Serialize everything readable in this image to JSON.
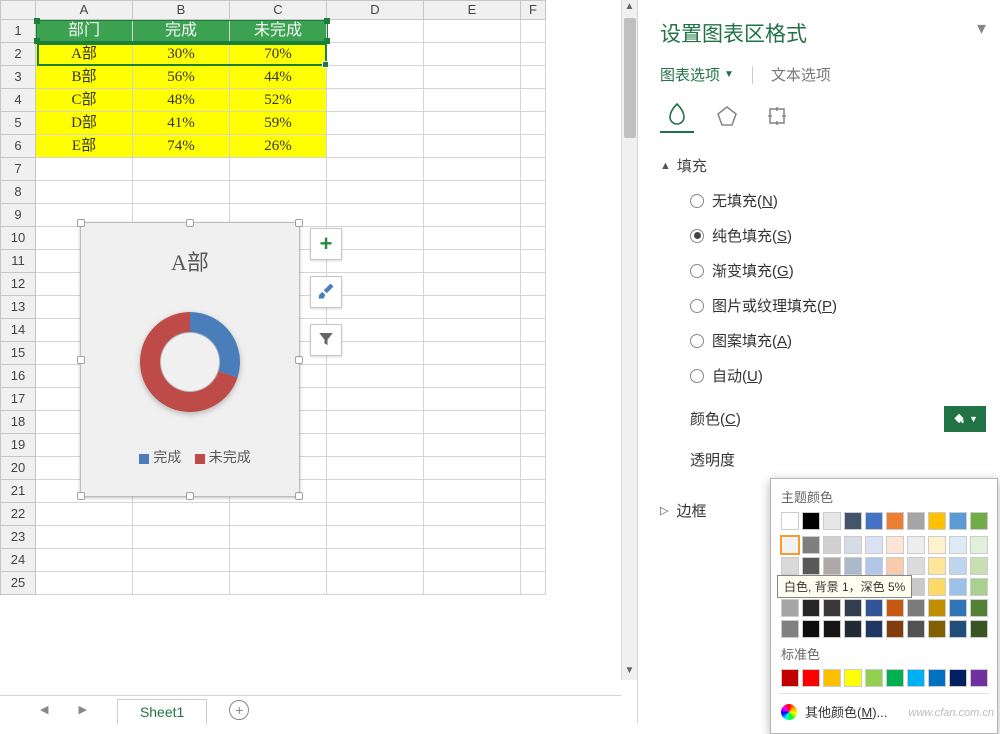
{
  "sheet": {
    "columns": [
      "A",
      "B",
      "C",
      "D",
      "E",
      "F"
    ],
    "row_numbers": [
      1,
      2,
      3,
      4,
      5,
      6,
      7,
      8,
      9,
      10,
      11,
      12,
      13,
      14,
      15,
      16,
      17,
      18,
      19,
      20,
      21,
      22,
      23,
      24,
      25
    ],
    "header_row": {
      "dept": "部门",
      "done": "完成",
      "undone": "未完成"
    },
    "data": [
      {
        "dept": "A部",
        "done": "30%",
        "undone": "70%"
      },
      {
        "dept": "B部",
        "done": "56%",
        "undone": "44%"
      },
      {
        "dept": "C部",
        "done": "48%",
        "undone": "52%"
      },
      {
        "dept": "D部",
        "done": "41%",
        "undone": "59%"
      },
      {
        "dept": "E部",
        "done": "74%",
        "undone": "26%"
      }
    ],
    "tab_name": "Sheet1"
  },
  "chart_data": {
    "type": "pie",
    "title": "A部",
    "series": [
      {
        "name": "完成",
        "value": 30,
        "color": "#4a7ebb"
      },
      {
        "name": "未完成",
        "value": 70,
        "color": "#be4b48"
      }
    ],
    "legend": {
      "done": "完成",
      "undone": "未完成"
    }
  },
  "pane": {
    "title": "设置图表区格式",
    "tab_chart_options": "图表选项",
    "tab_text_options": "文本选项",
    "section_fill": "填充",
    "radios": {
      "none": "无填充",
      "none_u": "N",
      "solid": "纯色填充",
      "solid_u": "S",
      "gradient": "渐变填充",
      "gradient_u": "G",
      "picture": "图片或纹理填充",
      "picture_u": "P",
      "pattern": "图案填充",
      "pattern_u": "A",
      "auto": "自动",
      "auto_u": "U"
    },
    "color_label": "颜色",
    "color_u": "C",
    "transparency_label": "透明度",
    "section_border": "边框"
  },
  "picker": {
    "theme_label": "主题颜色",
    "standard_label": "标准色",
    "tooltip": "白色, 背景 1，深色 5%",
    "more": "其他颜色",
    "more_u": "M",
    "theme_row0": [
      "#ffffff",
      "#000000",
      "#e7e6e6",
      "#44546a",
      "#4472c4",
      "#ed7d31",
      "#a5a5a5",
      "#ffc000",
      "#5b9bd5",
      "#70ad47"
    ],
    "theme_shades": [
      [
        "#f2f2f2",
        "#7f7f7f",
        "#d0cece",
        "#d6dce5",
        "#d9e1f2",
        "#fce4d6",
        "#ededed",
        "#fff2cc",
        "#ddebf7",
        "#e2efda"
      ],
      [
        "#d9d9d9",
        "#595959",
        "#aeaaaa",
        "#acb9ca",
        "#b4c6e7",
        "#f8cbad",
        "#dbdbdb",
        "#ffe699",
        "#bdd7ee",
        "#c6e0b4"
      ],
      [
        "#bfbfbf",
        "#404040",
        "#757171",
        "#8497b0",
        "#8ea9db",
        "#f4b084",
        "#c9c9c9",
        "#ffd966",
        "#9bc2e6",
        "#a9d08e"
      ],
      [
        "#a6a6a6",
        "#262626",
        "#3a3838",
        "#333f4f",
        "#305496",
        "#c65911",
        "#7b7b7b",
        "#bf8f00",
        "#2f75b5",
        "#548235"
      ],
      [
        "#808080",
        "#0d0d0d",
        "#161616",
        "#222b35",
        "#203764",
        "#833c0c",
        "#525252",
        "#806000",
        "#1f4e78",
        "#375623"
      ]
    ],
    "standard": [
      "#c00000",
      "#ff0000",
      "#ffc000",
      "#ffff00",
      "#92d050",
      "#00b050",
      "#00b0f0",
      "#0070c0",
      "#002060",
      "#7030a0"
    ]
  },
  "watermark": "www.cfan.com.cn"
}
